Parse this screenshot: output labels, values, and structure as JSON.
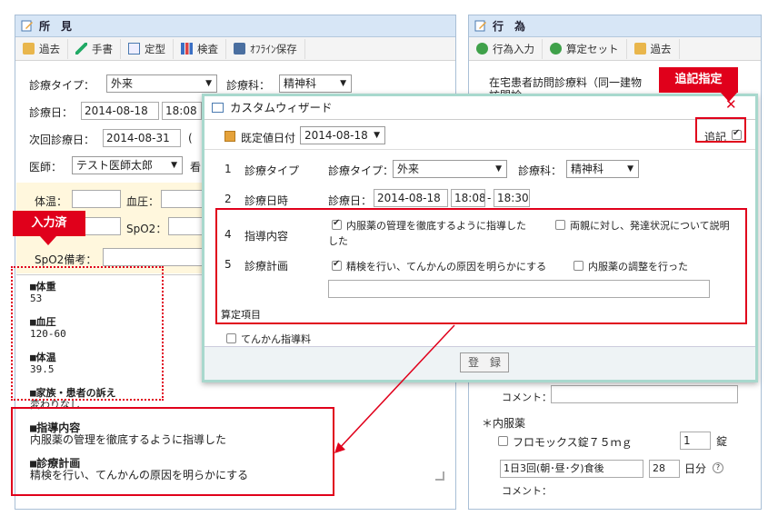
{
  "left_panel": {
    "title": "所　見",
    "toolbar": [
      "過去",
      "手書",
      "定型",
      "検査",
      "ｵﾌﾗｲﾝ保存"
    ],
    "type_label": "診療タイプ：",
    "type_value": "外来",
    "dept_label": "診療科：",
    "dept_value": "精神科",
    "date_label": "診療日：",
    "date_value": "2014-08-18",
    "time_value": "18:08",
    "next_label": "次回診療日：",
    "next_value": "2014-08-31",
    "next_suffix": "(",
    "doctor_label": "医師：",
    "doctor_value": "テスト医師太郎",
    "doctor_suffix": "看",
    "temp_label": "体温：",
    "bp_label": "血圧：",
    "spo2_label": "SpO2：",
    "spo2_note_label": "SpO2備考：",
    "notes_entered": [
      "■体重",
      "53",
      "",
      "■血圧",
      "120-60",
      "",
      "■体温",
      "39.5",
      "",
      "■家族・患者の訴え",
      "変わりなし"
    ],
    "notes_added": [
      "■指導内容",
      "内服薬の管理を徹底するように指導した",
      "",
      "■診療計画",
      "精検を行い、てんかんの原因を明らかにする"
    ]
  },
  "right_panel": {
    "title": "行　為",
    "toolbar": [
      "行為入力",
      "算定セット",
      "過去"
    ],
    "line1": "在宅患者訪問診療料（同一建物",
    "line2": "訪問診",
    "comment_label": "コメント：",
    "drug_section": "＊内服薬",
    "drug_name": "フロモックス錠７５ｍｇ",
    "drug_qty": "1",
    "drug_unit": "錠",
    "usage": "1日3回(朝･昼･夕)食後",
    "days": "28",
    "days_unit": "日分",
    "comment2_label": "コメント："
  },
  "wizard": {
    "title": "カスタムウィザード",
    "default_date_label": "既定値日付",
    "default_date_value": "2014-08-18",
    "append_label": "追記",
    "rows": [
      {
        "num": "1",
        "name": "診療タイプ"
      },
      {
        "num": "2",
        "name": "診療日時"
      },
      {
        "num": "4",
        "name": "指導内容"
      },
      {
        "num": "5",
        "name": "診療計画"
      }
    ],
    "type_label": "診療タイプ：",
    "type_value": "外来",
    "dept_label": "診療科：",
    "dept_value": "精神科",
    "date_label": "診療日：",
    "date_value": "2014-08-18",
    "time_from": "18:08",
    "time_to": "18:30",
    "guide_opt1": "内服薬の管理を徹底するように指導した",
    "guide_opt2": "両親に対し、発達状況について説明",
    "guide_opt2_cont": "した",
    "plan_opt1": "精検を行い、てんかんの原因を明らかにする",
    "plan_opt2": "内服薬の調整を行った",
    "calc_label": "算定項目",
    "calc_item": "てんかん指導料",
    "register_label": "登　録"
  },
  "callouts": {
    "entered": "入力済",
    "append": "追記指定"
  }
}
